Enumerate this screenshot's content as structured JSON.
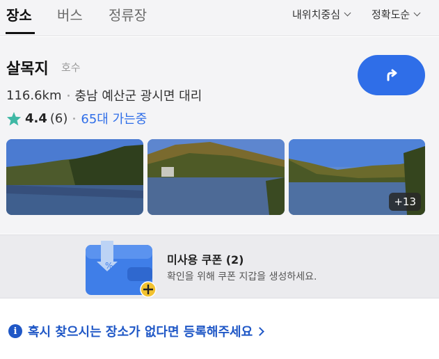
{
  "tabs": [
    {
      "label": "장소",
      "active": true
    },
    {
      "label": "버스",
      "active": false
    },
    {
      "label": "정류장",
      "active": false
    }
  ],
  "filters": {
    "location": "내위치중심",
    "sort": "정확도순"
  },
  "place": {
    "name": "살목지",
    "category": "호수",
    "distance": "116.6km",
    "address": "충남 예산군 광시면 대리",
    "rating": "4.4",
    "review_count": "(6)",
    "visits": "65대 가는중",
    "more_photos": "+13"
  },
  "coupon": {
    "title": "미사용 쿠폰 (2)",
    "subtitle": "확인을 위해 쿠폰 지갑을 생성하세요."
  },
  "register": {
    "text": "혹시 찾으시는 장소가 없다면 등록해주세요"
  },
  "colors": {
    "accent": "#2f6ee8",
    "link": "#1f57c6",
    "star": "#3fb8a5"
  }
}
